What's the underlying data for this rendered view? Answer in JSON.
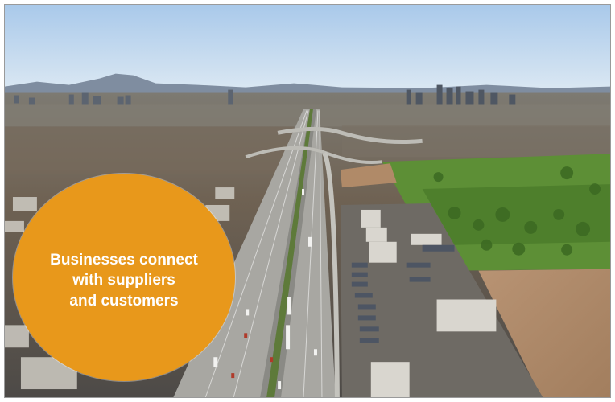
{
  "callout": {
    "lines": [
      "Businesses connect",
      "with suppliers",
      "and customers"
    ],
    "fill_color": "#e8981b",
    "text_color": "#ffffff"
  },
  "photo": {
    "sky_color": "#c9dff1",
    "ground_color": "#8a7258",
    "grass_color": "#5f8f3a"
  }
}
